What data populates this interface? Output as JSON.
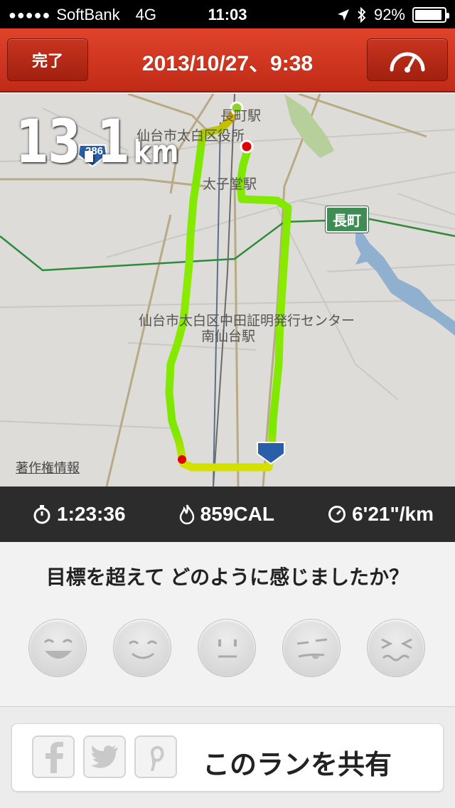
{
  "status_bar": {
    "carrier": "SoftBank",
    "network": "4G",
    "time": "11:03",
    "battery": "92%"
  },
  "nav": {
    "done_label": "完了",
    "title": "2013/10/27、9:38",
    "gauge_icon": "speedometer-icon"
  },
  "map": {
    "distance_value": "13.1",
    "distance_unit": "km",
    "label_ward_office": "仙台市太白区役所",
    "label_nagamachi_station": "長町駅",
    "label_taishido_station": "太子堂駅",
    "label_post_center": "仙台市太白区中田証明発行センター",
    "label_minami_sendai": "南仙台駅",
    "road_sign": "長町",
    "route_shield": "286",
    "copyright": "著作権情報"
  },
  "stats": {
    "duration": "1:23:36",
    "calories": "859CAL",
    "pace": "6'21\"/km"
  },
  "feedback": {
    "question": "目標を超えて どのように感じましたか？",
    "faces": [
      "very-happy-face-icon",
      "happy-face-icon",
      "neutral-face-icon",
      "unsure-face-icon",
      "tired-face-icon"
    ]
  },
  "share": {
    "label": "このランを共有",
    "networks": [
      "facebook-icon",
      "twitter-icon",
      "pinterest-icon"
    ]
  },
  "colors": {
    "brand_red": "#d23a22",
    "route_green": "#7de800",
    "start": "#8fd32a",
    "end": "#e00000"
  }
}
